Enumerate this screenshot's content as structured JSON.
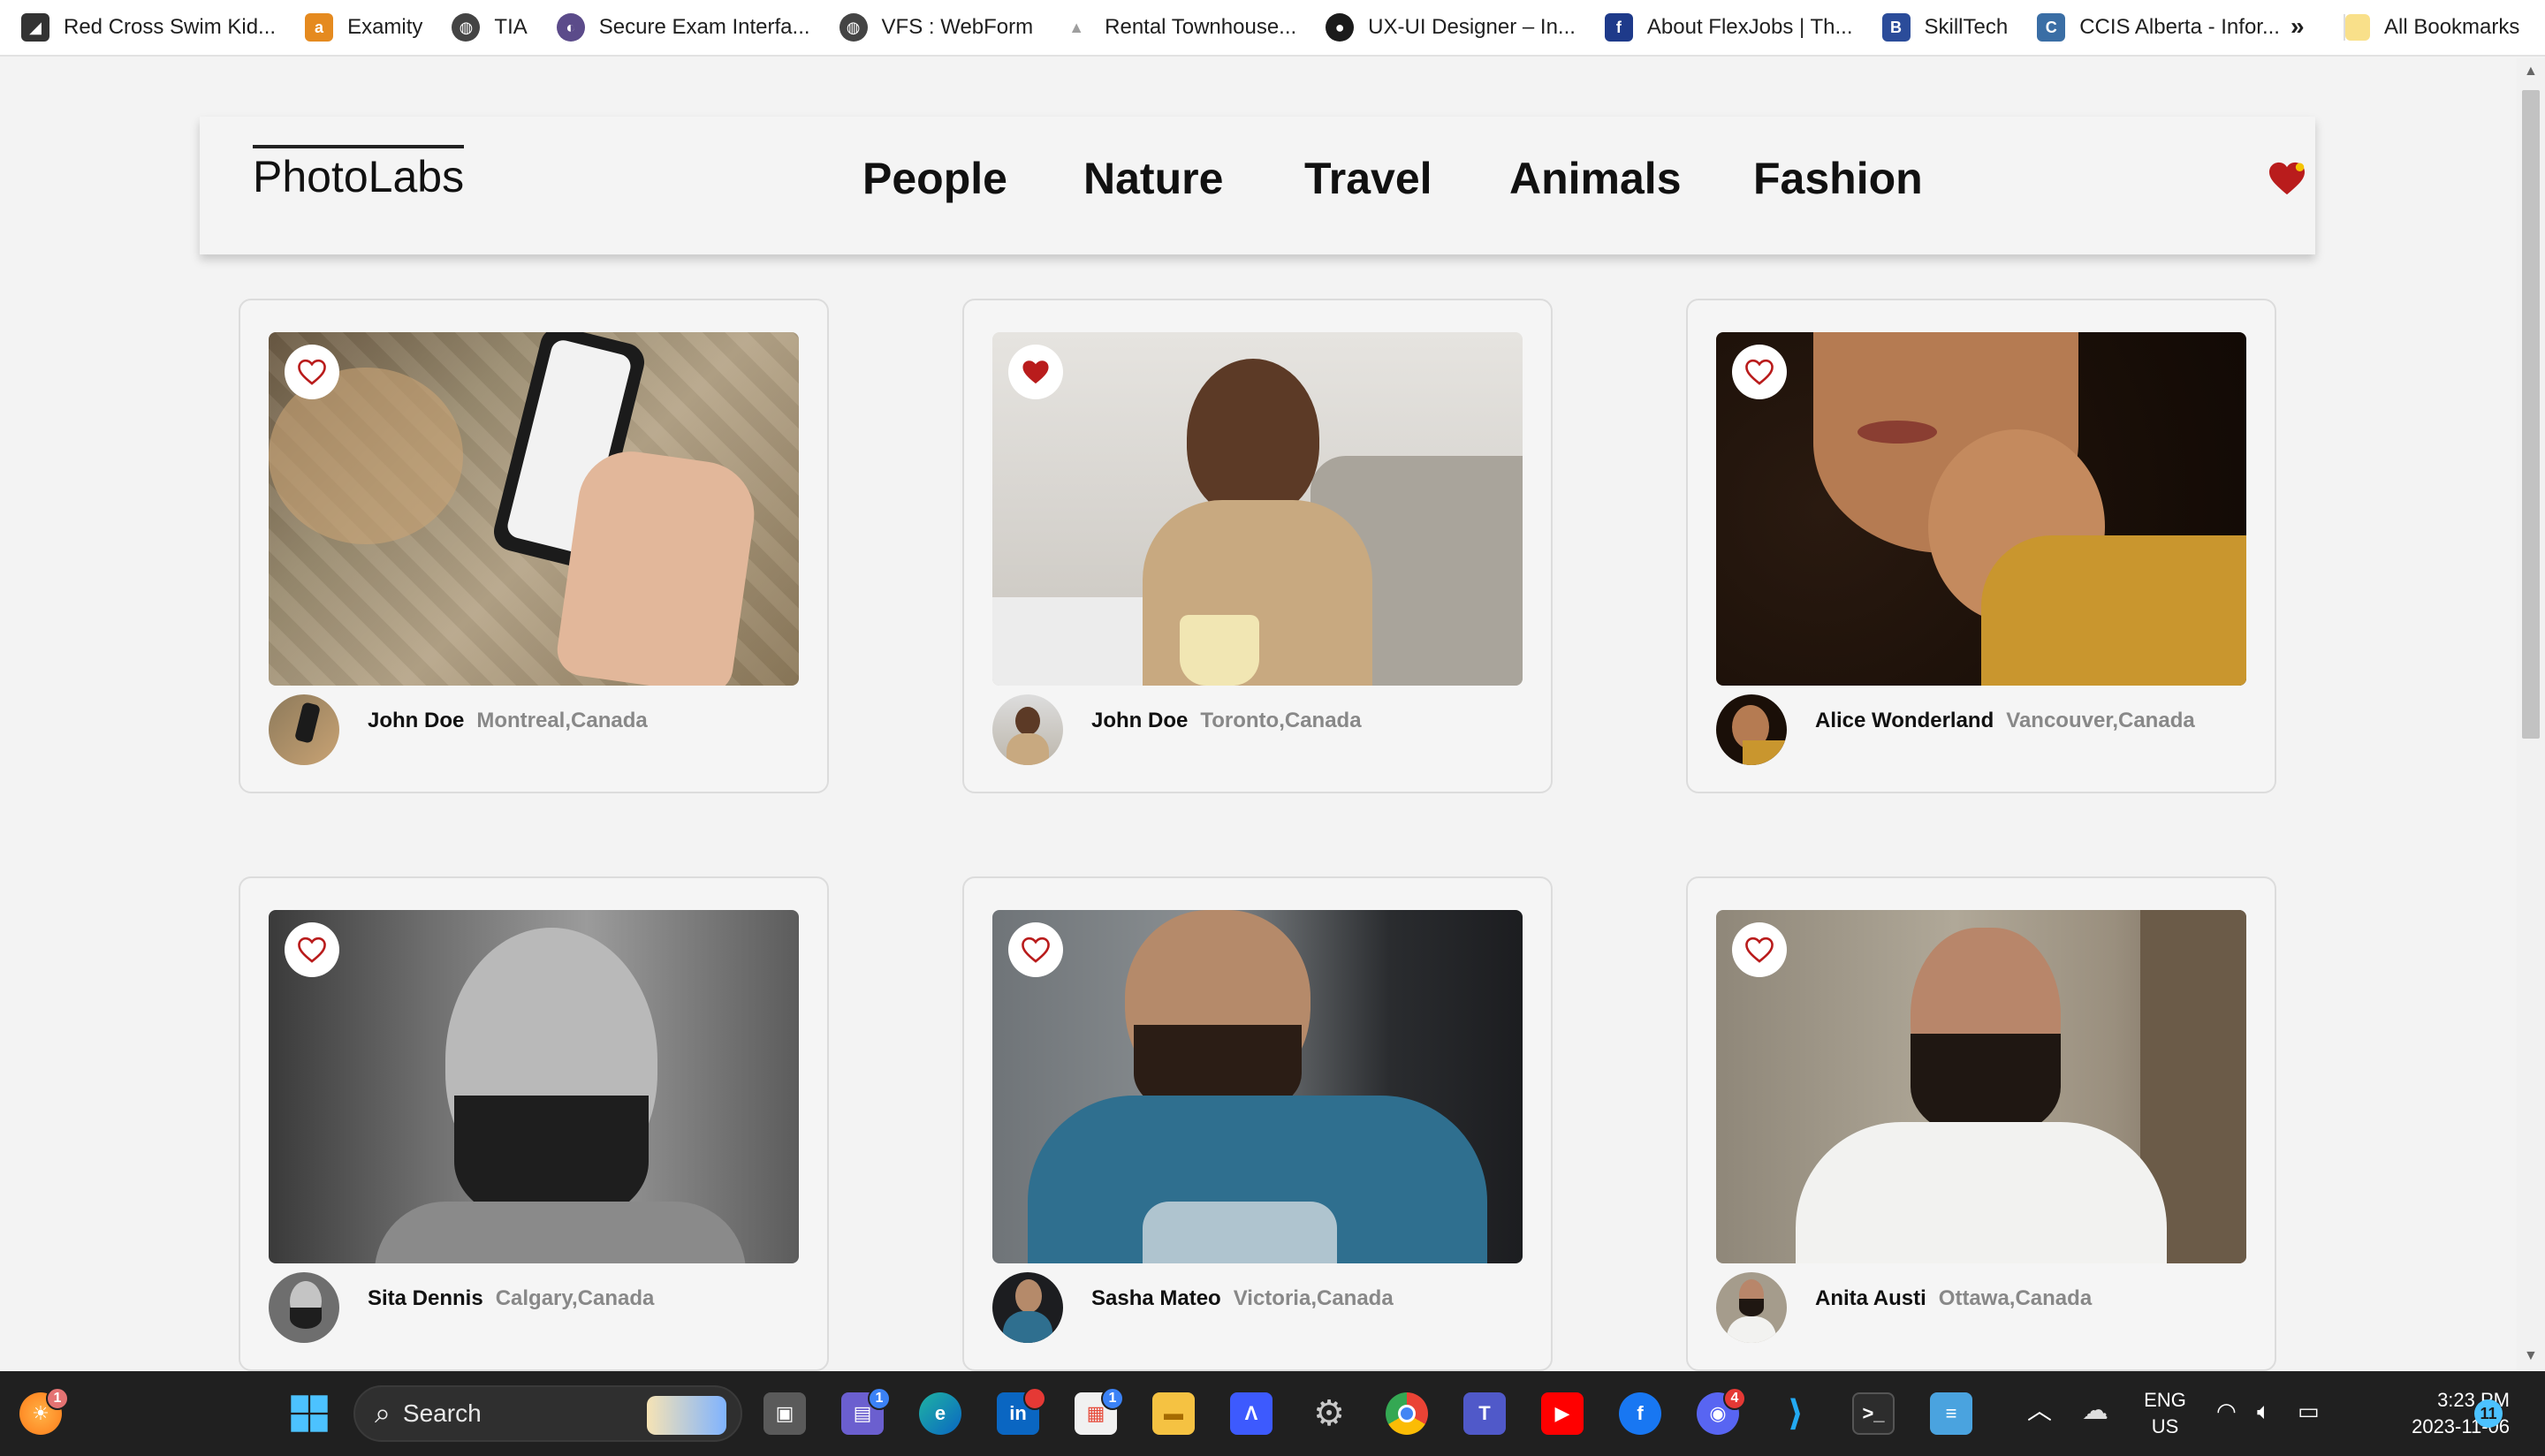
{
  "bookmarks": {
    "items": [
      {
        "label": "Red Cross Swim Kid...",
        "icon": "red-cross-swim-icon",
        "color": "#333333"
      },
      {
        "label": "Examity",
        "icon": "examity-icon",
        "color": "#e58a1f"
      },
      {
        "label": "TIA",
        "icon": "globe-icon",
        "color": "#444444"
      },
      {
        "label": "Secure Exam Interfa...",
        "icon": "secure-exam-icon",
        "color": "#5b4b8a"
      },
      {
        "label": "VFS : WebForm",
        "icon": "globe-icon",
        "color": "#444444"
      },
      {
        "label": "Rental Townhouse...",
        "icon": "rental-icon",
        "color": "#9e9e9e"
      },
      {
        "label": "UX-UI Designer – In...",
        "icon": "ux-designer-icon",
        "color": "#1b1b1b"
      },
      {
        "label": "About FlexJobs | Th...",
        "icon": "flexjobs-icon",
        "color": "#1e3a8a"
      },
      {
        "label": "SkillTech",
        "icon": "skilltech-icon",
        "color": "#2b4c9a"
      },
      {
        "label": "CCIS Alberta - Infor...",
        "icon": "ccis-icon",
        "color": "#3a6ea5"
      }
    ],
    "overflow": "»",
    "all_bookmarks": "All Bookmarks"
  },
  "app": {
    "logo": "PhotoLabs",
    "topics": [
      "People",
      "Nature",
      "Travel",
      "Animals",
      "Fashion"
    ],
    "accent": "#b91c1c"
  },
  "photos": [
    {
      "name": "John Doe",
      "location": "Montreal,Canada",
      "liked": false
    },
    {
      "name": "John Doe",
      "location": "Toronto,Canada",
      "liked": true
    },
    {
      "name": "Alice Wonderland",
      "location": "Vancouver,Canada",
      "liked": false
    },
    {
      "name": "Sita Dennis",
      "location": "Calgary,Canada",
      "liked": false
    },
    {
      "name": "Sasha Mateo",
      "location": "Victoria,Canada",
      "liked": false
    },
    {
      "name": "Anita Austi",
      "location": "Ottawa,Canada",
      "liked": false
    }
  ],
  "taskbar": {
    "search_placeholder": "Search",
    "widgets_badge": "1",
    "chat_badge": "1",
    "linkedin_badge": "",
    "store_badge": "1",
    "discord_badge": "4",
    "lang_top": "ENG",
    "lang_bottom": "US",
    "time": "3:23 PM",
    "date": "2023-11-06",
    "notifications": "11"
  }
}
